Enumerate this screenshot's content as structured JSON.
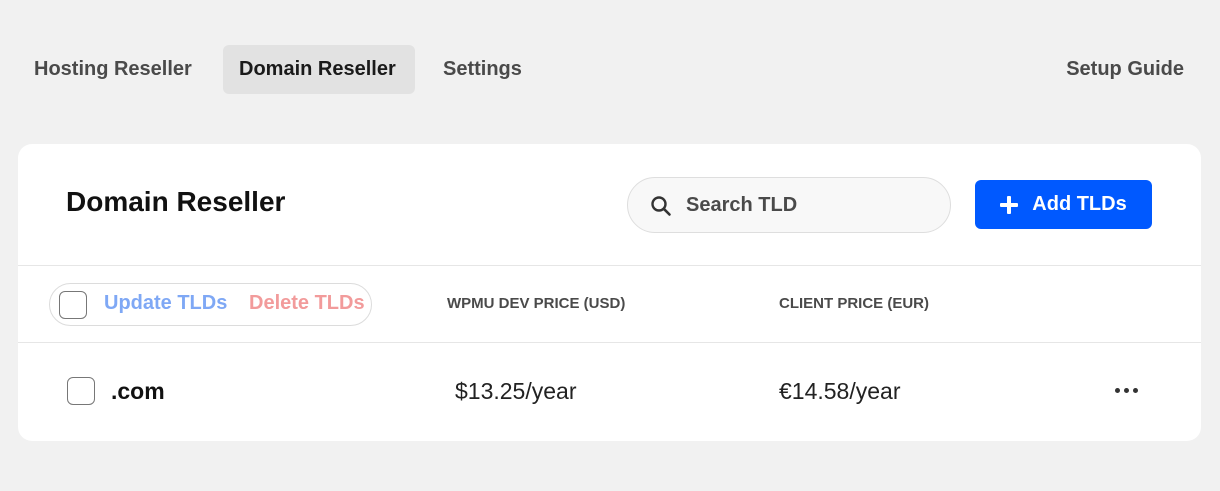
{
  "nav": {
    "tabs": [
      {
        "label": "Hosting Reseller",
        "active": false
      },
      {
        "label": "Domain Reseller",
        "active": true
      },
      {
        "label": "Settings",
        "active": false
      }
    ],
    "setup_guide_label": "Setup Guide"
  },
  "card": {
    "title": "Domain Reseller",
    "search": {
      "placeholder": "Search TLD",
      "value": "",
      "icon": "search-icon"
    },
    "add_button": {
      "label": "Add TLDs",
      "icon": "plus-icon"
    }
  },
  "table": {
    "bulk_actions": {
      "update_label": "Update TLDs",
      "delete_label": "Delete TLDs"
    },
    "columns": [
      "WPMU DEV PRICE (USD)",
      "CLIENT PRICE (EUR)"
    ],
    "rows": [
      {
        "tld": ".com",
        "wpmu_price": "$13.25/year",
        "client_price": "€14.58/year",
        "checked": false,
        "actions_icon": "more-horizontal-icon"
      }
    ]
  },
  "colors": {
    "page_background": "#f1f1f1",
    "card_background": "#ffffff",
    "primary_button": "#0059ff",
    "update_link": "#7fa8f5",
    "delete_link": "#f29b9b",
    "active_tab_background": "#e2e2e2"
  }
}
